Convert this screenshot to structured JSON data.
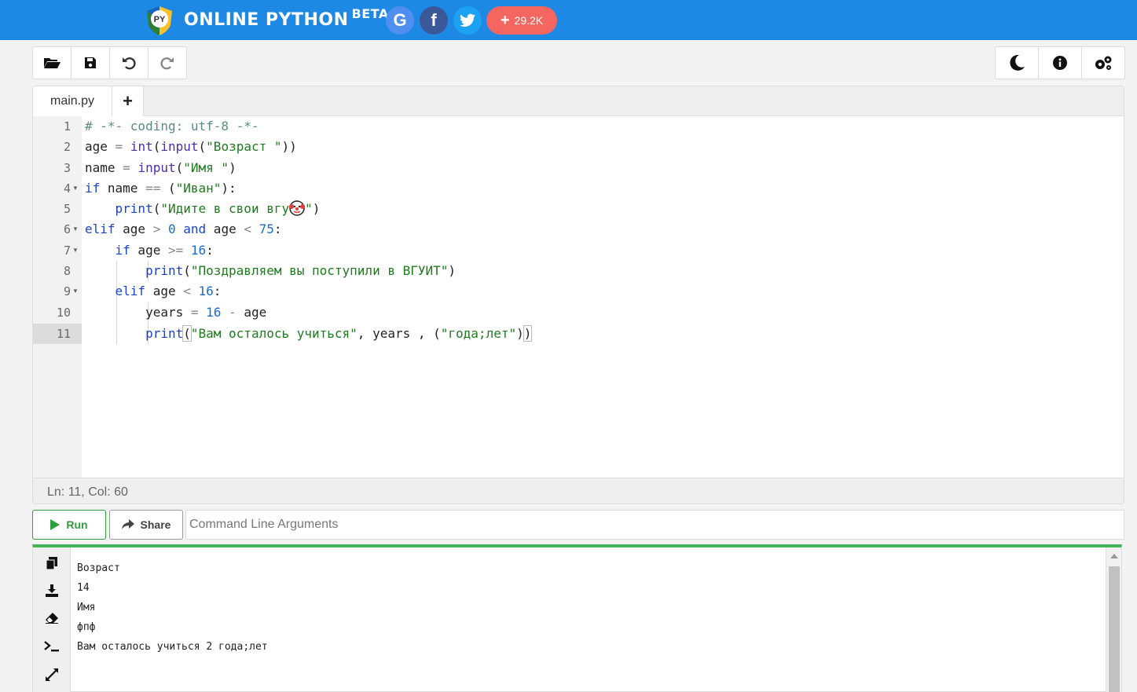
{
  "header": {
    "brand": "ONLINE PYTHON",
    "beta": "BETA",
    "logo_text": "PY",
    "social": [
      {
        "name": "google",
        "label": "G"
      },
      {
        "name": "facebook",
        "label": "f"
      },
      {
        "name": "twitter",
        "icon": "twitter-bird-icon"
      }
    ],
    "share_count": "29.2K"
  },
  "toolbar_left": [
    "open-folder-icon",
    "save-icon",
    "undo-icon",
    "redo-icon"
  ],
  "toolbar_right": [
    "moon-icon",
    "info-icon",
    "settings-icon"
  ],
  "editor": {
    "tab": "main.py",
    "add_tab": "+",
    "status": "Ln: 11,  Col: 60",
    "line_numbers": [
      "1",
      "2",
      "3",
      "4",
      "5",
      "6",
      "7",
      "8",
      "9",
      "10",
      "11"
    ]
  },
  "run_bar": {
    "run_label": "Run",
    "share_label": "Share",
    "args_placeholder": "Command Line Arguments"
  },
  "console": {
    "output": [
      "Возраст",
      "14",
      "Имя",
      "фпф",
      "Вам осталось учиться 2 года;лет"
    ]
  },
  "colors": {
    "header": "#1e88e5",
    "run": "#2e9e3f",
    "console_border": "#43b55a"
  }
}
